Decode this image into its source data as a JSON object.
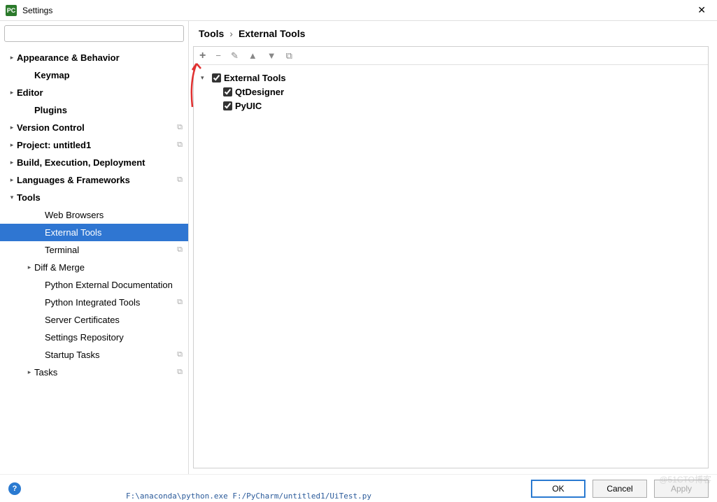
{
  "window": {
    "app_icon_text": "PC",
    "title": "Settings",
    "close_glyph": "✕"
  },
  "search": {
    "placeholder": ""
  },
  "sidebar": {
    "items": [
      {
        "label": "Appearance & Behavior",
        "depth": 0,
        "arrow": "collapsed",
        "bold": true,
        "copy": false
      },
      {
        "label": "Keymap",
        "depth": 1,
        "arrow": "none",
        "bold": true,
        "copy": false
      },
      {
        "label": "Editor",
        "depth": 0,
        "arrow": "collapsed",
        "bold": true,
        "copy": false
      },
      {
        "label": "Plugins",
        "depth": 1,
        "arrow": "none",
        "bold": true,
        "copy": false
      },
      {
        "label": "Version Control",
        "depth": 0,
        "arrow": "collapsed",
        "bold": true,
        "copy": true
      },
      {
        "label": "Project: untitled1",
        "depth": 0,
        "arrow": "collapsed",
        "bold": true,
        "copy": true
      },
      {
        "label": "Build, Execution, Deployment",
        "depth": 0,
        "arrow": "collapsed",
        "bold": true,
        "copy": false
      },
      {
        "label": "Languages & Frameworks",
        "depth": 0,
        "arrow": "collapsed",
        "bold": true,
        "copy": true
      },
      {
        "label": "Tools",
        "depth": 0,
        "arrow": "expanded",
        "bold": true,
        "copy": false
      },
      {
        "label": "Web Browsers",
        "depth": 2,
        "arrow": "none",
        "bold": false,
        "copy": false
      },
      {
        "label": "External Tools",
        "depth": 2,
        "arrow": "none",
        "bold": false,
        "copy": false,
        "selected": true
      },
      {
        "label": "Terminal",
        "depth": 2,
        "arrow": "none",
        "bold": false,
        "copy": true
      },
      {
        "label": "Diff & Merge",
        "depth": 1,
        "arrow": "collapsed",
        "bold": false,
        "copy": false
      },
      {
        "label": "Python External Documentation",
        "depth": 2,
        "arrow": "none",
        "bold": false,
        "copy": false
      },
      {
        "label": "Python Integrated Tools",
        "depth": 2,
        "arrow": "none",
        "bold": false,
        "copy": true
      },
      {
        "label": "Server Certificates",
        "depth": 2,
        "arrow": "none",
        "bold": false,
        "copy": false
      },
      {
        "label": "Settings Repository",
        "depth": 2,
        "arrow": "none",
        "bold": false,
        "copy": false
      },
      {
        "label": "Startup Tasks",
        "depth": 2,
        "arrow": "none",
        "bold": false,
        "copy": true
      },
      {
        "label": "Tasks",
        "depth": 1,
        "arrow": "collapsed",
        "bold": false,
        "copy": true
      }
    ]
  },
  "breadcrumb": {
    "root": "Tools",
    "sep": "›",
    "current": "External Tools"
  },
  "toolbar": {
    "add": "+",
    "remove": "−",
    "edit": "✎",
    "up": "▲",
    "down": "▼",
    "copy": "⧉"
  },
  "tools": {
    "group": "External Tools",
    "children": [
      "QtDesigner",
      "PyUIC"
    ]
  },
  "buttons": {
    "ok": "OK",
    "cancel": "Cancel",
    "apply": "Apply",
    "help": "?"
  },
  "watermark": "@51CTO博客",
  "status_path": "F:\\anaconda\\python.exe F:/PyCharm/untitled1/UiTest.py"
}
